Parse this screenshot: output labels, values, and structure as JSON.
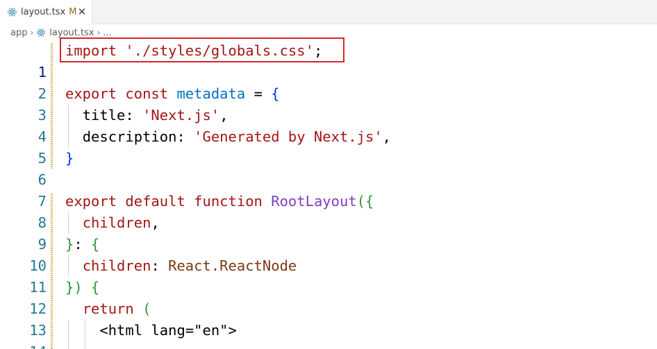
{
  "tab": {
    "file_name": "layout.tsx",
    "modified_badge": "M",
    "close_glyph": "✕",
    "icon": "react-icon"
  },
  "breadcrumb": {
    "folder": "app",
    "file": "layout.tsx",
    "more": "...",
    "separator": "›"
  },
  "editor": {
    "lines": [
      {
        "number": "1",
        "text": "import './styles/globals.css';"
      },
      {
        "number": "2",
        "text": ""
      },
      {
        "number": "3",
        "text": "export const metadata = {"
      },
      {
        "number": "4",
        "text": "  title: 'Next.js',"
      },
      {
        "number": "5",
        "text": "  description: 'Generated by Next.js',"
      },
      {
        "number": "6",
        "text": "}"
      },
      {
        "number": "7",
        "text": ""
      },
      {
        "number": "8",
        "text": "export default function RootLayout({"
      },
      {
        "number": "9",
        "text": "  children,"
      },
      {
        "number": "10",
        "text": "}: {"
      },
      {
        "number": "11",
        "text": "  children: React.ReactNode"
      },
      {
        "number": "12",
        "text": "}) {"
      },
      {
        "number": "13",
        "text": "  return ("
      },
      {
        "number": "14",
        "text": "    <html lang=\"en\">"
      }
    ],
    "tokens": {
      "l1": [
        "import",
        "'./styles/globals.css'",
        ";"
      ],
      "l3": [
        "export",
        "const",
        "metadata",
        "=",
        "{"
      ],
      "l4": [
        "title",
        ":",
        "'Next.js'",
        ","
      ],
      "l5": [
        "description",
        ":",
        "'Generated by Next.js'",
        ","
      ],
      "l6": [
        "}"
      ],
      "l8": [
        "export",
        "default",
        "function",
        "RootLayout",
        "(",
        "{"
      ],
      "l9": [
        "children",
        ","
      ],
      "l10": [
        "}",
        ":",
        "{"
      ],
      "l11": [
        "children",
        ":",
        "React.ReactNode"
      ],
      "l12": [
        "}",
        ")",
        "{"
      ],
      "l13": [
        "return",
        "("
      ],
      "l14": [
        "<",
        "html",
        "lang",
        "=",
        "\"en\"",
        ">"
      ]
    }
  },
  "colors": {
    "keyword": "#a31515",
    "string": "#a31515",
    "function_name": "#795e26",
    "line_number": "#237893",
    "highlight_box": "#d6232a"
  }
}
